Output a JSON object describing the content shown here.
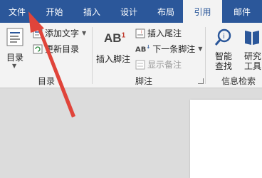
{
  "tabs": [
    {
      "label": "文件"
    },
    {
      "label": "开始"
    },
    {
      "label": "插入"
    },
    {
      "label": "设计"
    },
    {
      "label": "布局"
    },
    {
      "label": "引用"
    },
    {
      "label": "邮件"
    }
  ],
  "toc_group": {
    "big_button": "目录",
    "add_text": "添加文字",
    "update_toc": "更新目录",
    "label": "目录"
  },
  "footnote_group": {
    "insert_footnote": "插入脚注",
    "insert_endnote": "插入尾注",
    "next_footnote": "下一条脚注",
    "show_notes": "显示备注",
    "label": "脚注"
  },
  "research_group": {
    "smart_lookup_line1": "智能",
    "smart_lookup_line2": "查找",
    "researcher_line1": "研究",
    "researcher_line2": "工具",
    "label": "信息检索"
  },
  "colors": {
    "ribbon_blue": "#2b579a",
    "arrow_red": "#e0443a"
  }
}
